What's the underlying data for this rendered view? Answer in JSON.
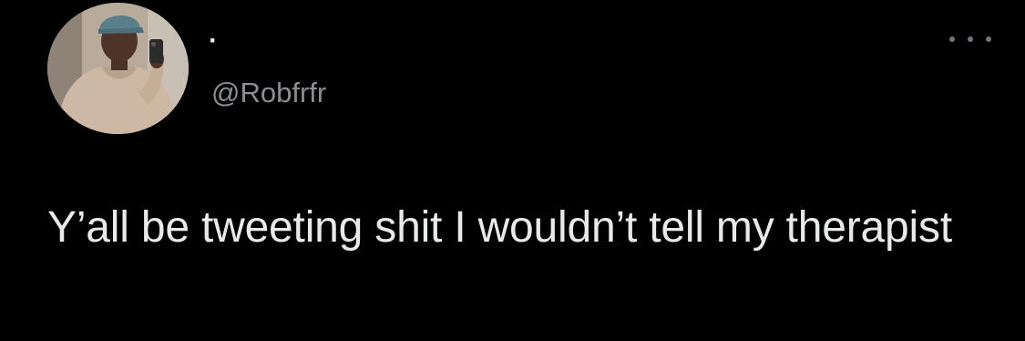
{
  "tweet": {
    "display_name": "·",
    "handle": "@Robfrfr",
    "text": "Y’all be tweeting shit I wouldn’t tell my therapist"
  },
  "icons": {
    "more": "more-options-icon"
  },
  "colors": {
    "background": "#000000",
    "text": "#e7e9ea",
    "secondary_text": "#8b8f93"
  }
}
